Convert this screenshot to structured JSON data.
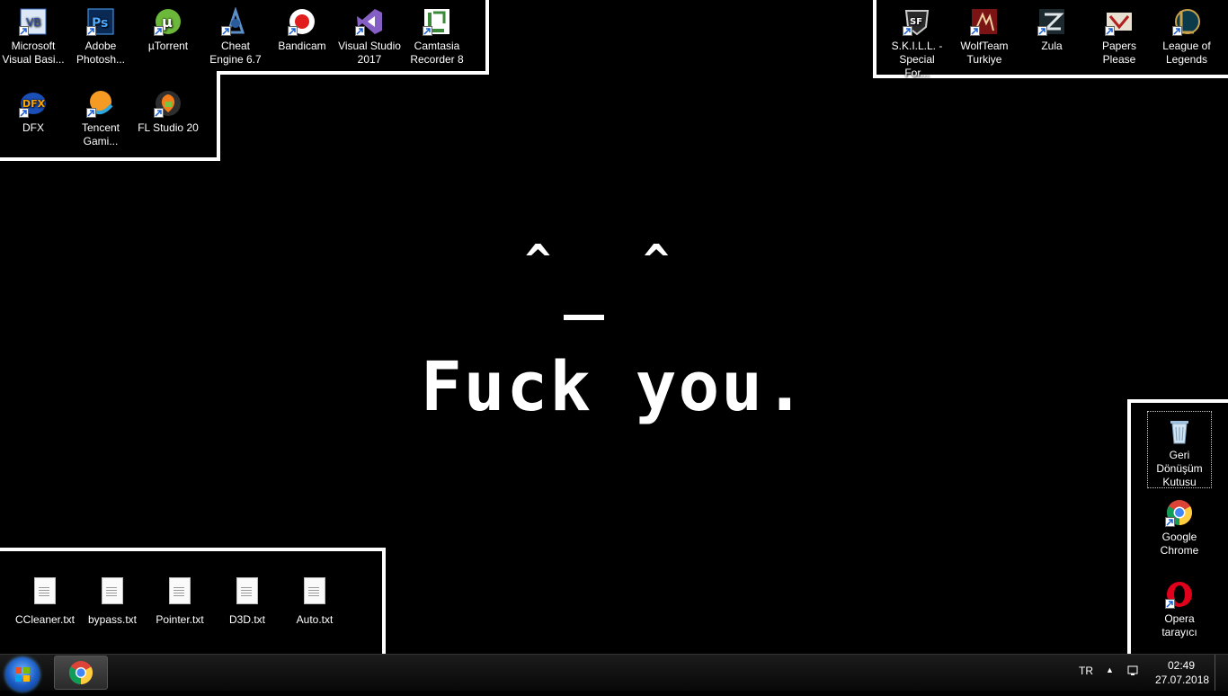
{
  "desktop": {
    "top_left_icons": [
      {
        "label": "Microsoft Visual Basi...",
        "icon": "visual-basic-icon"
      },
      {
        "label": "Adobe Photosh...",
        "icon": "photoshop-icon"
      },
      {
        "label": "µTorrent",
        "icon": "utorrent-icon"
      },
      {
        "label": "Cheat Engine 6.7",
        "icon": "cheat-engine-icon"
      },
      {
        "label": "Bandicam",
        "icon": "bandicam-icon"
      },
      {
        "label": "Visual Studio 2017",
        "icon": "visual-studio-icon"
      },
      {
        "label": "Camtasia Recorder 8",
        "icon": "camtasia-icon"
      },
      {
        "label": "DFX",
        "icon": "dfx-icon"
      },
      {
        "label": "Tencent Gami...",
        "icon": "tencent-gaming-icon"
      },
      {
        "label": "FL Studio 20",
        "icon": "fl-studio-icon"
      }
    ],
    "top_right_icons": [
      {
        "label": "S.K.I.L.L. - Special For...",
        "icon": "skill-icon"
      },
      {
        "label": "WolfTeam Turkiye",
        "icon": "wolfteam-icon"
      },
      {
        "label": "Zula",
        "icon": "zula-icon"
      },
      {
        "label": "Papers Please",
        "icon": "papers-please-icon"
      },
      {
        "label": "League of Legends",
        "icon": "league-of-legends-icon"
      }
    ],
    "right_icons": [
      {
        "label": "Geri Dönüşüm Kutusu",
        "icon": "recycle-bin-icon"
      },
      {
        "label": "Google Chrome",
        "icon": "chrome-icon"
      },
      {
        "label": "Opera tarayıcı",
        "icon": "opera-icon"
      }
    ],
    "bottom_left_files": [
      {
        "label": "CCleaner.txt"
      },
      {
        "label": "bypass.txt"
      },
      {
        "label": "Pointer.txt"
      },
      {
        "label": "D3D.txt"
      },
      {
        "label": "Auto.txt"
      }
    ],
    "wallpaper": {
      "eyes": "^   ^",
      "mouth": "_",
      "message": "Fuck you."
    }
  },
  "taskbar": {
    "language": "TR",
    "time": "02:49",
    "date": "27.07.2018",
    "pinned": [
      {
        "icon": "chrome-icon"
      }
    ]
  }
}
